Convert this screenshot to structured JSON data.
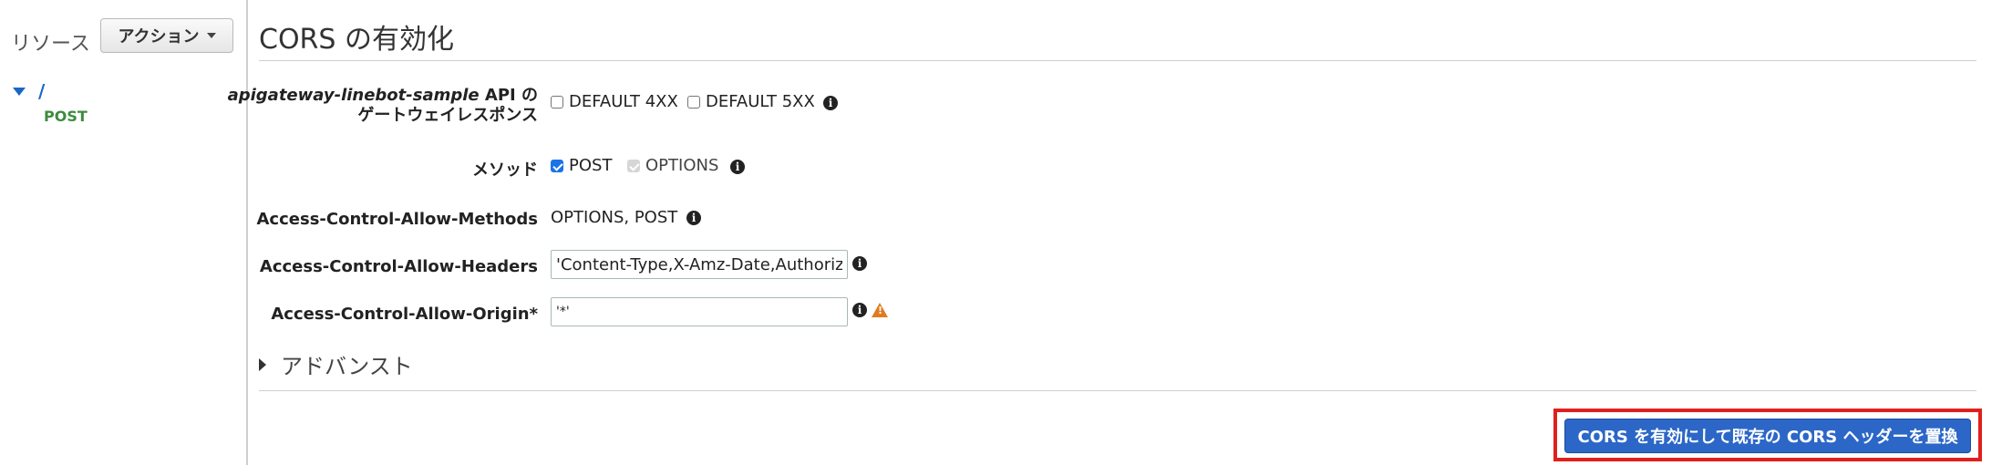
{
  "sidebar": {
    "resources_label": "リソース",
    "actions_button": "アクション",
    "tree_root": "/",
    "tree_method": "POST"
  },
  "main": {
    "title": "CORS の有効化",
    "gateway_label_api": "apigateway-linebot-sample",
    "gateway_label_rest": " API の",
    "gateway_label_line2": "ゲートウェイレスポンス",
    "gateway_options": [
      "DEFAULT 4XX",
      "DEFAULT 5XX"
    ],
    "method_label": "メソッド",
    "method_options": [
      {
        "label": "POST",
        "checked": true,
        "disabled": false
      },
      {
        "label": "OPTIONS",
        "checked": true,
        "disabled": true
      }
    ],
    "allow_methods_label": "Access-Control-Allow-Methods",
    "allow_methods_value": "OPTIONS, POST",
    "allow_headers_label": "Access-Control-Allow-Headers",
    "allow_headers_value": "'Content-Type,X-Amz-Date,Authoriz",
    "allow_origin_label": "Access-Control-Allow-Origin*",
    "allow_origin_value": "'*'",
    "advanced_label": "アドバンスト",
    "submit_button": "CORS を有効にして既存の CORS ヘッダーを置換"
  },
  "colors": {
    "accent": "#1a66c7",
    "primary_button": "#2c67c7",
    "highlight_border": "#e0201d",
    "warning": "#e07b1f",
    "method_green": "#3d8b3d"
  },
  "icons": [
    "info-icon",
    "warning-icon",
    "caret-down-icon",
    "caret-right-icon"
  ]
}
